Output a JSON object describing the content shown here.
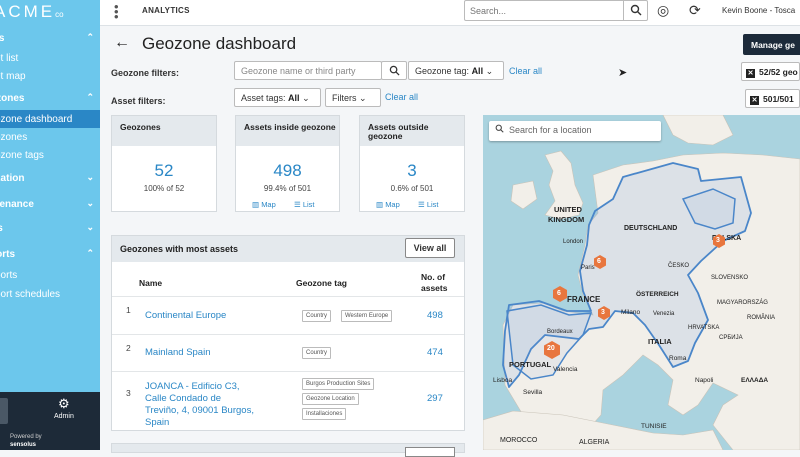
{
  "sidebar": {
    "logo": "ACME",
    "logo_suffix": "co",
    "sections": [
      {
        "label": "ets"
      },
      {
        "label": "ozones"
      },
      {
        "label": "lization"
      },
      {
        "label": "ntenance"
      },
      {
        "label": "rts"
      },
      {
        "label": "ports"
      }
    ],
    "items": [
      {
        "label": "et list"
      },
      {
        "label": "et map"
      },
      {
        "label": "ozone dashboard"
      },
      {
        "label": "ozones"
      },
      {
        "label": "ozone tags"
      },
      {
        "label": "ports"
      },
      {
        "label": "port schedules"
      }
    ],
    "admin_label": "Admin",
    "powered_by": "Powered by",
    "powered_brand": "sensolus"
  },
  "topbar": {
    "section": "ANALYTICS",
    "search_placeholder": "Search...",
    "user": "Kevin Boone - Tosca"
  },
  "page": {
    "title": "Geozone dashboard",
    "manage_button": "Manage ge",
    "geozone_filters_label": "Geozone filters:",
    "geozone_search_placeholder": "Geozone name or third party",
    "geozone_tag_label": "Geozone tag:",
    "geozone_tag_value": "All",
    "clear_all": "Clear all",
    "asset_filters_label": "Asset filters:",
    "asset_tags_label": "Asset tags:",
    "asset_tags_value": "All",
    "filters_label": "Filters",
    "clear_all_2": "Clear all",
    "chip1": "52/52 geo",
    "chip2": "501/501"
  },
  "cards": [
    {
      "title": "Geozones",
      "value": "52",
      "pct": "100% of 52"
    },
    {
      "title": "Assets inside geozone",
      "value": "498",
      "pct": "99.4% of 501",
      "map": "Map",
      "list": "List"
    },
    {
      "title": "Assets outside geozone",
      "value": "3",
      "pct": "0.6% of 501",
      "map": "Map",
      "list": "List"
    }
  ],
  "table": {
    "title": "Geozones with most assets",
    "view_all": "View all",
    "col_name": "Name",
    "col_tag": "Geozone tag",
    "col_assets": "No. of assets",
    "rows": [
      {
        "n": "1",
        "name": "Continental Europe",
        "tags": [
          "Country",
          "Western Europe"
        ],
        "count": "498"
      },
      {
        "n": "2",
        "name": "Mainland Spain",
        "tags": [
          "Country"
        ],
        "count": "474"
      },
      {
        "n": "3",
        "name": "JOANCA - Edificio C3, Calle Condado de Treviño, 4, 09001 Burgos, Spain",
        "tags": [
          "Burgos Production Sites",
          "Geozone Location",
          "Installaciones"
        ],
        "count": "297"
      }
    ]
  },
  "map": {
    "search_placeholder": "Search for a location",
    "labels": [
      "UNITED",
      "KINGDOM",
      "DEUTSCHLAND",
      "POLSKA",
      "ČESKO",
      "SLOVENSKO",
      "FRANCE",
      "ÖSTERREICH",
      "MAGYARORSZÁG",
      "Milano",
      "Venezia",
      "HRVATSKA",
      "ITALIA",
      "ROMÂNIA",
      "СРБИЈА",
      "PORTUGAL",
      "Valencia",
      "Roma",
      "Napoli",
      "Lisboa",
      "Sevilla",
      "ΕΛΛΑΔΑ",
      "MOROCCO",
      "ALGERIA",
      "TUNISIE",
      "Paris",
      "Bordeaux",
      "London"
    ],
    "clusters": [
      "3",
      "6",
      "3",
      "6",
      "20"
    ]
  }
}
